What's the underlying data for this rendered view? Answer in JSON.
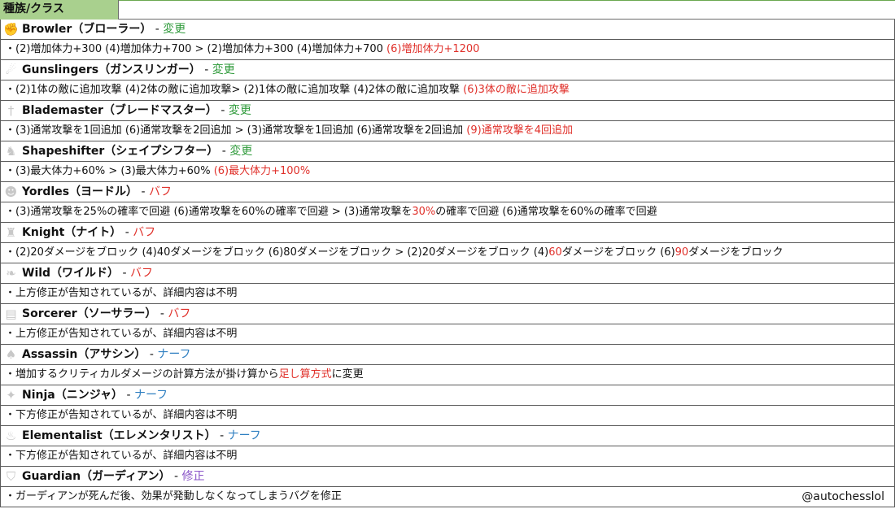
{
  "header": {
    "title": "種族/クラス"
  },
  "classes": [
    {
      "icon": "fist-icon",
      "glyph": "✊",
      "name": "Browler（ブローラー）",
      "sep": " - ",
      "tag": "変更",
      "tag_type": "change",
      "detail": [
        {
          "t": "・(2)増加体力+300 (4)増加体力+700 > (2)増加体力+300 (4)増加体力+700 "
        },
        {
          "t": "(6)増加体力+1200",
          "red": true
        }
      ]
    },
    {
      "icon": "gun-icon",
      "glyph": "☄",
      "name": "Gunslingers（ガンスリンガー）",
      "sep": " - ",
      "tag": "変更",
      "tag_type": "change",
      "detail": [
        {
          "t": "・(2)1体の敵に追加攻撃 (4)2体の敵に追加攻撃> (2)1体の敵に追加攻撃 (4)2体の敵に追加攻撃 "
        },
        {
          "t": "(6)3体の敵に追加攻撃",
          "red": true
        }
      ]
    },
    {
      "icon": "sword-icon",
      "glyph": "†",
      "name": "Blademaster（ブレードマスター）",
      "sep": " - ",
      "tag": "変更",
      "tag_type": "change",
      "detail": [
        {
          "t": "・(3)通常攻撃を1回追加 (6)通常攻撃を2回追加 > (3)通常攻撃を1回追加 (6)通常攻撃を2回追加 "
        },
        {
          "t": "(9)通常攻撃を4回追加",
          "red": true
        }
      ]
    },
    {
      "icon": "figure-icon",
      "glyph": "♞",
      "name": "Shapeshifter（シェイプシフター）",
      "sep": " - ",
      "tag": "変更",
      "tag_type": "change",
      "detail": [
        {
          "t": "・(3)最大体力+60% > (3)最大体力+60% "
        },
        {
          "t": "(6)最大体力+100%",
          "red": true
        }
      ]
    },
    {
      "icon": "yordle-icon",
      "glyph": "☻",
      "name": "Yordles（ヨードル）",
      "sep": " - ",
      "tag": "バフ",
      "tag_type": "buff",
      "detail": [
        {
          "t": "・(3)通常攻撃を25%の確率で回避 (6)通常攻撃を60%の確率で回避 > (3)通常攻撃を"
        },
        {
          "t": "30%",
          "red": true
        },
        {
          "t": "の確率で回避 (6)通常攻撃を60%の確率で回避"
        }
      ]
    },
    {
      "icon": "helmet-icon",
      "glyph": "♜",
      "name": "Knight（ナイト）",
      "sep": " - ",
      "tag": "バフ",
      "tag_type": "buff",
      "detail": [
        {
          "t": "・(2)20ダメージをブロック (4)40ダメージをブロック (6)80ダメージをブロック > (2)20ダメージをブロック (4)"
        },
        {
          "t": "60",
          "red": true
        },
        {
          "t": "ダメージをブロック (6)"
        },
        {
          "t": "90",
          "red": true
        },
        {
          "t": "ダメージをブロック"
        }
      ]
    },
    {
      "icon": "paw-icon",
      "glyph": "❧",
      "name": "Wild（ワイルド）",
      "sep": " - ",
      "tag": "バフ",
      "tag_type": "buff",
      "detail": [
        {
          "t": "・上方修正が告知されているが、詳細内容は不明"
        }
      ]
    },
    {
      "icon": "book-icon",
      "glyph": "▤",
      "name": "Sorcerer（ソーサラー）",
      "sep": " - ",
      "tag": "バフ",
      "tag_type": "buff",
      "detail": [
        {
          "t": "・上方修正が告知されているが、詳細内容は不明"
        }
      ]
    },
    {
      "icon": "hood-icon",
      "glyph": "♠",
      "name": "Assassin（アサシン）",
      "sep": " - ",
      "tag": "ナーフ",
      "tag_type": "nerf",
      "detail": [
        {
          "t": "・増加するクリティカルダメージの計算方法が掛け算から"
        },
        {
          "t": "足し算方式",
          "red": true
        },
        {
          "t": "に変更"
        }
      ]
    },
    {
      "icon": "shuriken-icon",
      "glyph": "✦",
      "name": "Ninja（ニンジャ）",
      "sep": " - ",
      "tag": "ナーフ",
      "tag_type": "nerf",
      "detail": [
        {
          "t": "・下方修正が告知されているが、詳細内容は不明"
        }
      ]
    },
    {
      "icon": "flame-icon",
      "glyph": "♨",
      "name": "Elementalist（エレメンタリスト）",
      "sep": " - ",
      "tag": "ナーフ",
      "tag_type": "nerf",
      "detail": [
        {
          "t": "・下方修正が告知されているが、詳細内容は不明"
        }
      ]
    },
    {
      "icon": "shield-icon",
      "glyph": "⛉",
      "name": "Guardian（ガーディアン）",
      "sep": " - ",
      "tag": "修正",
      "tag_type": "fix",
      "detail": [
        {
          "t": "・ガーディアンが死んだ後、効果が発動しなくなってしまうバグを修正"
        }
      ]
    }
  ],
  "credit": "@autochesslol"
}
